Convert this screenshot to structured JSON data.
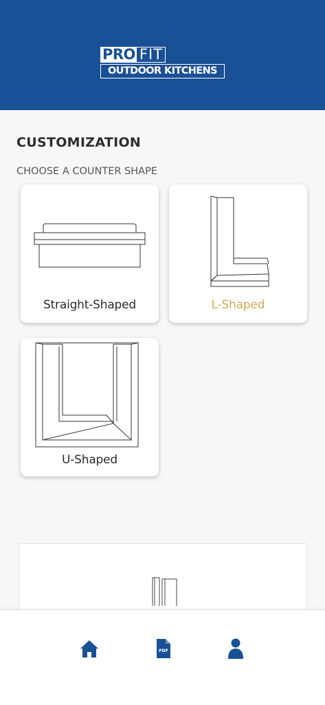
{
  "header": {
    "logo_pro": "PRO",
    "logo_fit": "FIT",
    "logo_tagline": "OUTDOOR KITCHENS",
    "background_color": "#1a5096"
  },
  "main": {
    "title": "CUSTOMIZATION",
    "subtitle": "CHOOSE A COUNTER SHAPE",
    "shapes": [
      {
        "label": "Straight-Shaped",
        "icon": "straight-counter-icon",
        "selected": false
      },
      {
        "label": "L-Shaped",
        "icon": "l-counter-icon",
        "selected": true
      },
      {
        "label": "U-Shaped",
        "icon": "u-counter-icon",
        "selected": false
      }
    ],
    "selected_color": "#d4a959"
  },
  "bottom_nav": {
    "items": [
      {
        "icon": "home-icon"
      },
      {
        "icon": "pdf-icon",
        "label": "PDF"
      },
      {
        "icon": "profile-icon"
      }
    ]
  }
}
